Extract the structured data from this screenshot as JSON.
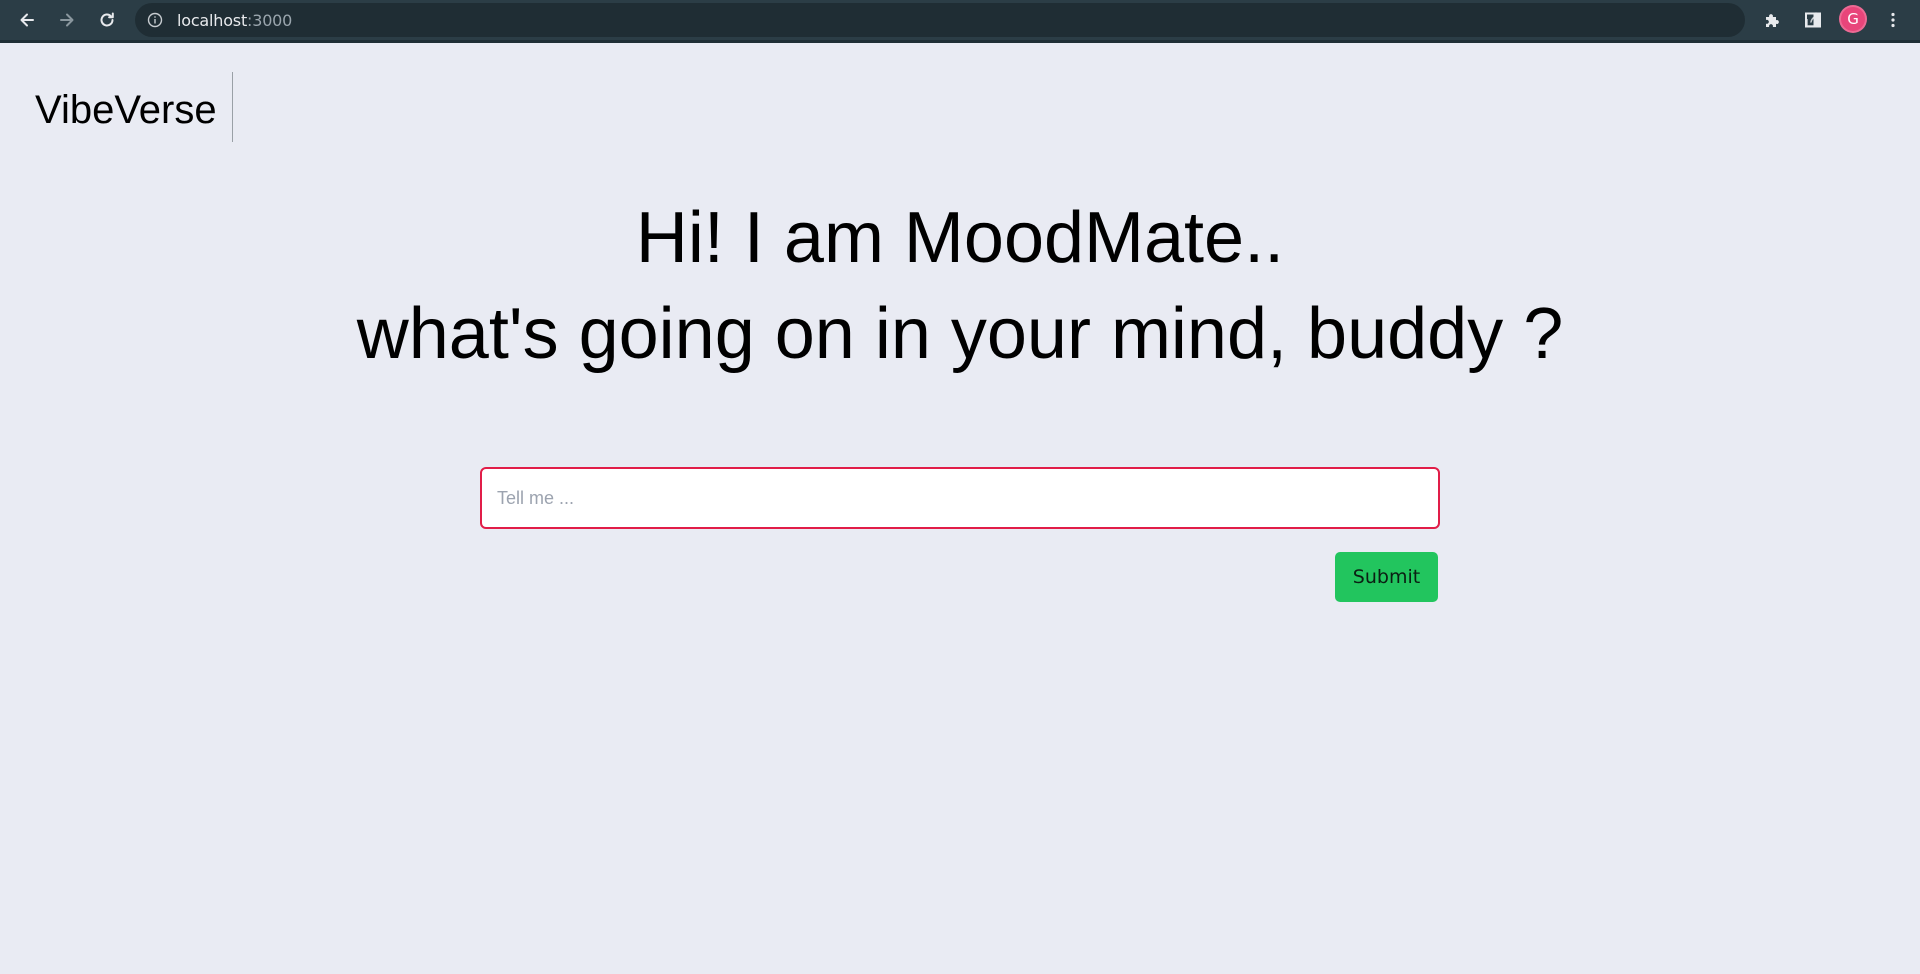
{
  "browser": {
    "url_host": "localhost",
    "url_port": ":3000",
    "avatar_letter": "G",
    "icons": {
      "back": "arrow-left-icon",
      "forward": "arrow-right-icon",
      "reload": "reload-icon",
      "info": "info-icon",
      "share": "share-icon",
      "bookmark": "star-icon",
      "extensions": "puzzle-icon",
      "side_panel": "side-panel-icon",
      "menu": "kebab-menu-icon"
    },
    "colors": {
      "toolbar": "#2b3d46",
      "omnibox": "#1f2d34",
      "avatar": "#e8457a"
    }
  },
  "header": {
    "brand": "VibeVerse"
  },
  "main": {
    "headline_line1": "Hi! I am MoodMate..",
    "headline_line2": "what's going on in your mind, buddy ?",
    "input_placeholder": "Tell me ...",
    "input_value": "",
    "submit_label": "Submit"
  },
  "colors": {
    "page_background": "#e9ebf3",
    "input_border": "#e11d48",
    "submit_background": "#22c55e"
  }
}
